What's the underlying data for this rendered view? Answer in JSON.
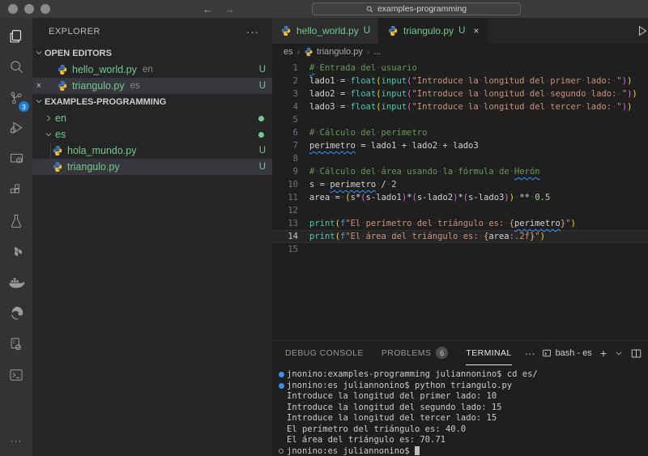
{
  "colors": {
    "accent": "#007acc",
    "git_modified": "#73c991",
    "badge_blue": "#1f7fd4",
    "comment_green": "#6a9955",
    "string_orange": "#ce9178",
    "function_teal": "#4ec9b0"
  },
  "titlebar": {
    "search_value": "examples-programming",
    "back_arrow": "←",
    "forward_arrow": "→"
  },
  "activity_bar": {
    "items": [
      {
        "icon": "files-icon",
        "label": "explorer",
        "active": true
      },
      {
        "icon": "search-icon",
        "label": "search"
      },
      {
        "icon": "source-control-icon",
        "label": "source-control",
        "badge": "3"
      },
      {
        "icon": "run-debug-icon",
        "label": "run-and-debug"
      },
      {
        "icon": "remote-explorer-icon",
        "label": "remote-explorer"
      },
      {
        "icon": "extensions-icon",
        "label": "extensions"
      },
      {
        "icon": "test-beaker-icon",
        "label": "testing"
      },
      {
        "icon": "terraform-icon",
        "label": "terraform"
      },
      {
        "icon": "docker-icon",
        "label": "docker"
      },
      {
        "icon": "edge-icon",
        "label": "edge-tools"
      },
      {
        "icon": "cmake-icon",
        "label": "cmake"
      },
      {
        "icon": "terminal-icon",
        "label": "terminal-tool"
      }
    ],
    "more_label": "···"
  },
  "sidebar": {
    "title": "EXPLORER",
    "more_label": "···",
    "open_editors": {
      "header": "OPEN EDITORS",
      "items": [
        {
          "label": "hello_world.py",
          "desc": "en",
          "badge": "U",
          "selected": false,
          "close": false
        },
        {
          "label": "triangulo.py",
          "desc": "es",
          "badge": "U",
          "selected": true,
          "close": true
        }
      ]
    },
    "workspace": {
      "header": "EXAMPLES-PROGRAMMING",
      "items": [
        {
          "kind": "folder",
          "label": "en",
          "expanded": false,
          "dot": true
        },
        {
          "kind": "folder",
          "label": "es",
          "expanded": true,
          "dot": true
        },
        {
          "kind": "file",
          "label": "hola_mundo.py",
          "badge": "U",
          "child": true,
          "selected": false
        },
        {
          "kind": "file",
          "label": "triangulo.py",
          "badge": "U",
          "child": true,
          "selected": true
        }
      ]
    }
  },
  "tabs": [
    {
      "label": "hello_world.py",
      "badge": "U",
      "active": false,
      "close": false
    },
    {
      "label": "triangulo.py",
      "badge": "U",
      "active": true,
      "close": true
    }
  ],
  "breadcrumb": [
    {
      "label": "es"
    },
    {
      "label": "triangulo.py",
      "icon": "python"
    },
    {
      "label": "..."
    }
  ],
  "editor": {
    "current_line": 14,
    "lines": [
      {
        "n": 1,
        "t": [
          [
            "cm",
            "#",
            1
          ],
          [
            "cm",
            " Entrada del usuario"
          ]
        ]
      },
      {
        "n": 2,
        "t": [
          [
            "v",
            "lado1"
          ],
          [
            "op",
            " = "
          ],
          [
            "fn",
            "float"
          ],
          [
            "p1",
            "("
          ],
          [
            "fn",
            "input"
          ],
          [
            "p2",
            "("
          ],
          [
            "s",
            "\"Introduce la longitud del primer lado: \""
          ],
          [
            "p2",
            ")"
          ],
          [
            "p1",
            ")"
          ]
        ]
      },
      {
        "n": 3,
        "t": [
          [
            "v",
            "lado2"
          ],
          [
            "op",
            " = "
          ],
          [
            "fn",
            "float"
          ],
          [
            "p1",
            "("
          ],
          [
            "fn",
            "input"
          ],
          [
            "p2",
            "("
          ],
          [
            "s",
            "\"Introduce la longitud del segundo lado: \""
          ],
          [
            "p2",
            ")"
          ],
          [
            "p1",
            ")"
          ]
        ]
      },
      {
        "n": 4,
        "t": [
          [
            "v",
            "lado3"
          ],
          [
            "op",
            " = "
          ],
          [
            "fn",
            "float"
          ],
          [
            "p1",
            "("
          ],
          [
            "fn",
            "input"
          ],
          [
            "p2",
            "("
          ],
          [
            "s",
            "\"Introduce la longitud del tercer lado: \""
          ],
          [
            "p2",
            ")"
          ],
          [
            "p1",
            ")"
          ]
        ]
      },
      {
        "n": 5,
        "t": []
      },
      {
        "n": 6,
        "t": [
          [
            "cm",
            "# Cálculo del perímetro"
          ]
        ]
      },
      {
        "n": 7,
        "t": [
          [
            "v",
            "perimetro",
            1
          ],
          [
            "op",
            " = "
          ],
          [
            "v",
            "lado1"
          ],
          [
            "op",
            " + "
          ],
          [
            "v",
            "lado2"
          ],
          [
            "op",
            " + "
          ],
          [
            "v",
            "lado3"
          ]
        ]
      },
      {
        "n": 8,
        "t": []
      },
      {
        "n": 9,
        "t": [
          [
            "cm",
            "# Cálculo del área usando la fórmula de "
          ],
          [
            "cm",
            "Herón",
            1
          ]
        ]
      },
      {
        "n": 10,
        "t": [
          [
            "v",
            "s"
          ],
          [
            "op",
            " = "
          ],
          [
            "v",
            "perimetro",
            1
          ],
          [
            "op",
            " / "
          ],
          [
            "n",
            "2"
          ]
        ]
      },
      {
        "n": 11,
        "t": [
          [
            "v",
            "area"
          ],
          [
            "op",
            " = "
          ],
          [
            "p1",
            "("
          ],
          [
            "v",
            "s"
          ],
          [
            "op",
            "*"
          ],
          [
            "p2",
            "("
          ],
          [
            "v",
            "s"
          ],
          [
            "op",
            "-"
          ],
          [
            "v",
            "lado1"
          ],
          [
            "p2",
            ")"
          ],
          [
            "op",
            "*"
          ],
          [
            "p2",
            "("
          ],
          [
            "v",
            "s"
          ],
          [
            "op",
            "-"
          ],
          [
            "v",
            "lado2"
          ],
          [
            "p2",
            ")"
          ],
          [
            "op",
            "*"
          ],
          [
            "p2",
            "("
          ],
          [
            "v",
            "s"
          ],
          [
            "op",
            "-"
          ],
          [
            "v",
            "lado3"
          ],
          [
            "p2",
            ")"
          ],
          [
            "p1",
            ")"
          ],
          [
            "op",
            " ** "
          ],
          [
            "n",
            "0.5"
          ]
        ]
      },
      {
        "n": 12,
        "t": []
      },
      {
        "n": 13,
        "t": [
          [
            "fn",
            "print"
          ],
          [
            "p1",
            "("
          ],
          [
            "k",
            "f"
          ],
          [
            "s",
            "\"El perímetro del triángulo es: "
          ],
          [
            "fb",
            "{"
          ],
          [
            "v",
            "perimetro",
            1
          ],
          [
            "fb",
            "}"
          ],
          [
            "s",
            "\""
          ],
          [
            "p1",
            ")"
          ]
        ]
      },
      {
        "n": 14,
        "t": [
          [
            "fn",
            "print"
          ],
          [
            "p1",
            "("
          ],
          [
            "k",
            "f"
          ],
          [
            "s",
            "\"El área del triángulo es: "
          ],
          [
            "fb",
            "{"
          ],
          [
            "v",
            "area"
          ],
          [
            "fmt",
            ":.2f"
          ],
          [
            "fb",
            "}"
          ],
          [
            "s",
            "\""
          ],
          [
            "p1",
            ")"
          ]
        ]
      },
      {
        "n": 15,
        "t": []
      }
    ]
  },
  "panel": {
    "tabs": [
      {
        "label": "DEBUG CONSOLE",
        "active": false
      },
      {
        "label": "PROBLEMS",
        "badge": "6",
        "active": false
      },
      {
        "label": "TERMINAL",
        "active": true
      }
    ],
    "more_label": "···",
    "instance_label": "bash - es"
  },
  "terminal": {
    "lines": [
      {
        "m": "done",
        "text": "jnonino:examples-programming juliannonino$ cd es/"
      },
      {
        "m": "done",
        "text": "jnonino:es juliannonino$ python triangulo.py"
      },
      {
        "text": "Introduce la longitud del primer lado: 10"
      },
      {
        "text": "Introduce la longitud del segundo lado: 15"
      },
      {
        "text": "Introduce la longitud del tercer lado: 15"
      },
      {
        "text": "El perímetro del triángulo es: 40.0"
      },
      {
        "text": "El área del triángulo es: 70.71"
      },
      {
        "m": "current",
        "text": "jnonino:es juliannonino$ ",
        "cursor": true
      }
    ]
  }
}
